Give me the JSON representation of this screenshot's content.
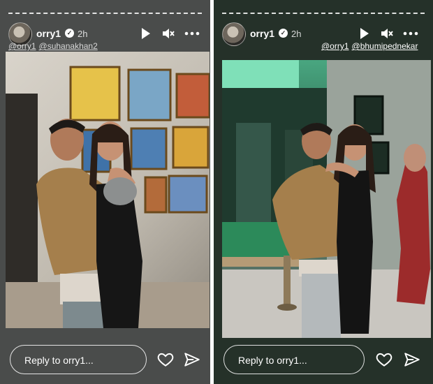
{
  "stories": [
    {
      "username": "orry1",
      "time": "2h",
      "mentions": [
        "@orry1",
        "@suhanakhan2"
      ],
      "reply_placeholder": "Reply to orry1..."
    },
    {
      "username": "orry1",
      "time": "2h",
      "mentions": [
        "@orry1",
        "@bhumipednekar"
      ],
      "reply_placeholder": "Reply to orry1..."
    }
  ],
  "icons": {
    "play": "play-icon",
    "mute": "mute-icon",
    "more": "more-icon",
    "like": "heart-icon",
    "share": "send-icon",
    "verified": "verified-badge-icon"
  },
  "colors": {
    "left_bg": "#4a4c4b",
    "right_bg": "#253129",
    "text": "#ffffff"
  }
}
